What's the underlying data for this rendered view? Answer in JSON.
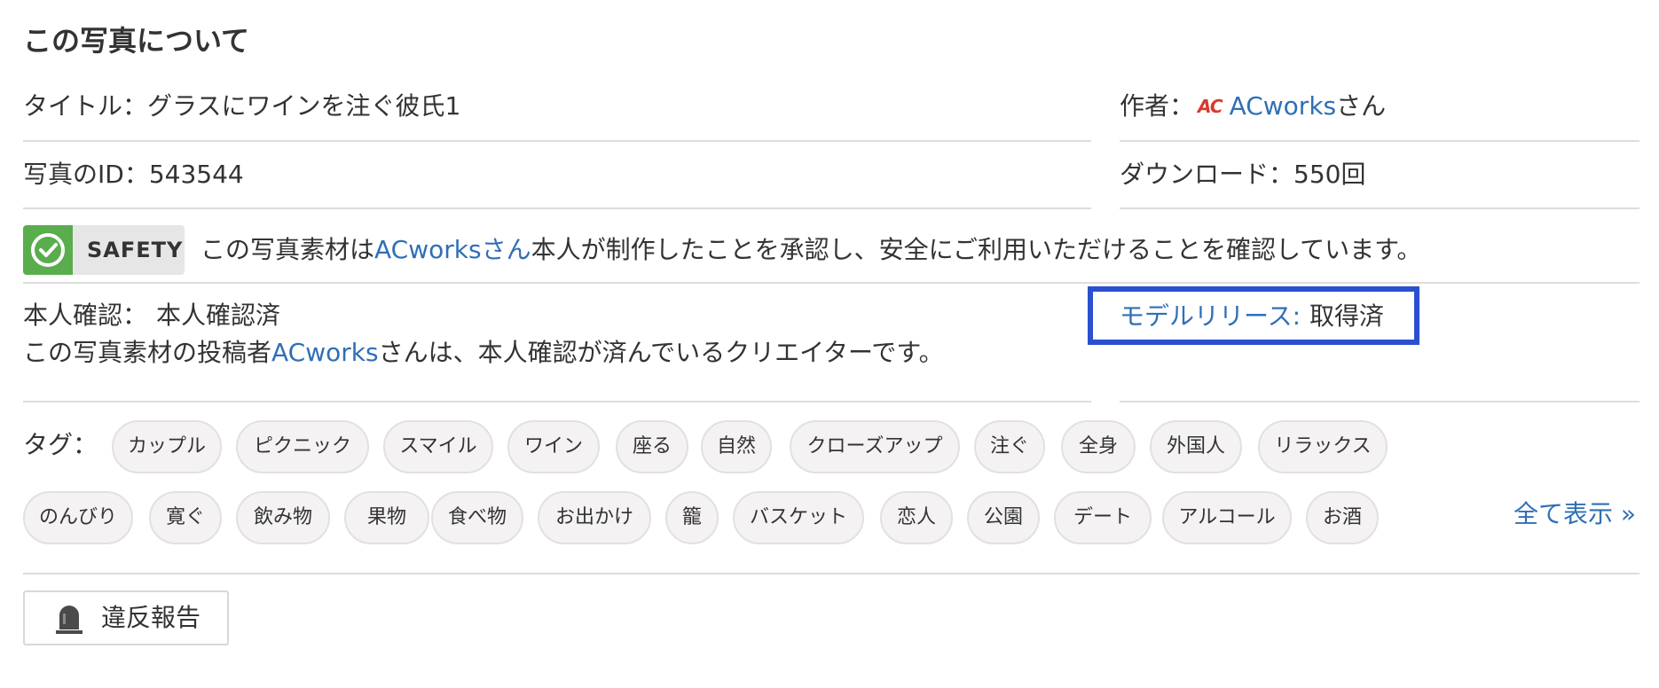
{
  "about": {
    "heading": "この写真について",
    "title_label": "タイトル：",
    "title_value": "グラスにワインを注ぐ彼氏1",
    "author_label": "作者：",
    "author_logo": "AC",
    "author_name": "ACworks",
    "author_suffix": "さん",
    "id_label": "写真のID：",
    "id_value": "543544",
    "download_label": "ダウンロード：",
    "download_value": "550回"
  },
  "safety": {
    "badge_label": "SAFETY",
    "text_pre": "この写真素材は",
    "text_link": "ACworksさん",
    "text_post": "本人が制作したことを承認し、安全にご利用いただけることを確認しています。",
    "icon": "check-circle-icon",
    "icon_color": "#5aad4d"
  },
  "verification": {
    "label": "本人確認：",
    "value": "本人確認済",
    "desc_pre": "この写真素材の投稿者",
    "desc_link": "ACworks",
    "desc_post": "さんは、本人確認が済んでいるクリエイターです。"
  },
  "model_release": {
    "label": "モデルリリース:",
    "value": "取得済",
    "highlight_color": "#2a4fcf"
  },
  "tags": {
    "label": "タグ：",
    "row1": [
      "カップル",
      "ピクニック",
      "スマイル",
      "ワイン",
      "座る",
      "自然",
      "クローズアップ",
      "注ぐ",
      "全身",
      "外国人",
      "リラックス"
    ],
    "row2": [
      "のんびり",
      "寛ぐ",
      "飲み物",
      "果物",
      "食べ物",
      "お出かけ",
      "籠",
      "バスケット",
      "恋人",
      "公園",
      "デート",
      "アルコール",
      "お酒"
    ],
    "show_all": "全て表示 »"
  },
  "report": {
    "label": "違反報告",
    "icon": "siren-icon"
  },
  "colors": {
    "link": "#2f6fb6",
    "text": "#333333",
    "divider": "#dddddd"
  }
}
